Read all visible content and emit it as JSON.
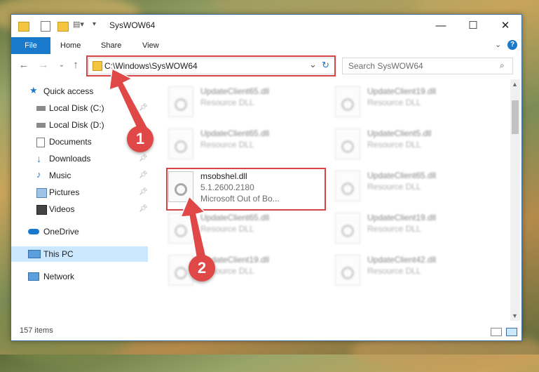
{
  "window": {
    "title": "SysWOW64",
    "controls": {
      "minimize": "—",
      "maximize": "☐",
      "close": "✕"
    }
  },
  "ribbon": {
    "tabs": [
      {
        "label": "File"
      },
      {
        "label": "Home"
      },
      {
        "label": "Share"
      },
      {
        "label": "View"
      }
    ],
    "expand_icon": "chevron-down-icon",
    "help_icon": "help-icon"
  },
  "address": {
    "path": "C:\\Windows\\SysWOW64",
    "refresh_glyph": "↻",
    "dropdown_glyph": "⌄"
  },
  "search": {
    "placeholder": "Search SysWOW64"
  },
  "sidebar": {
    "items": [
      {
        "label": "Quick access",
        "pinned": false
      },
      {
        "label": "Local Disk (C:)",
        "pinned": true
      },
      {
        "label": "Local Disk (D:)",
        "pinned": false
      },
      {
        "label": "Documents",
        "pinned": true
      },
      {
        "label": "Downloads",
        "pinned": true
      },
      {
        "label": "Music",
        "pinned": true
      },
      {
        "label": "Pictures",
        "pinned": true
      },
      {
        "label": "Videos",
        "pinned": true
      },
      {
        "label": "OneDrive",
        "pinned": false
      },
      {
        "label": "This PC",
        "pinned": false
      },
      {
        "label": "Network",
        "pinned": false
      }
    ]
  },
  "files": {
    "left": [
      {
        "name": "UpdateClient65.dll",
        "type": "Resource DLL"
      },
      {
        "name": "UpdateClient65.dll",
        "type": "Resource DLL"
      },
      {
        "name": "msobshel.dll",
        "version": "5.1.2600.2180",
        "company": "Microsoft Out of Bo..."
      },
      {
        "name": "UpdateClient65.dll",
        "type": "Resource DLL"
      },
      {
        "name": "UpdateClient19.dll",
        "type": "Resource DLL"
      }
    ],
    "right": [
      {
        "name": "UpdateClient19.dll",
        "type": "Resource DLL"
      },
      {
        "name": "UpdateClient5.dll",
        "type": "Resource DLL"
      },
      {
        "name": "UpdateClient65.dll",
        "type": "Resource DLL"
      },
      {
        "name": "UpdateClient19.dll",
        "type": "Resource DLL"
      },
      {
        "name": "UpdateClient42.dll",
        "type": "Resource DLL"
      }
    ]
  },
  "status": {
    "item_count": "157 items"
  },
  "annotations": {
    "step1": "1",
    "step2": "2",
    "color": "#e04848"
  }
}
